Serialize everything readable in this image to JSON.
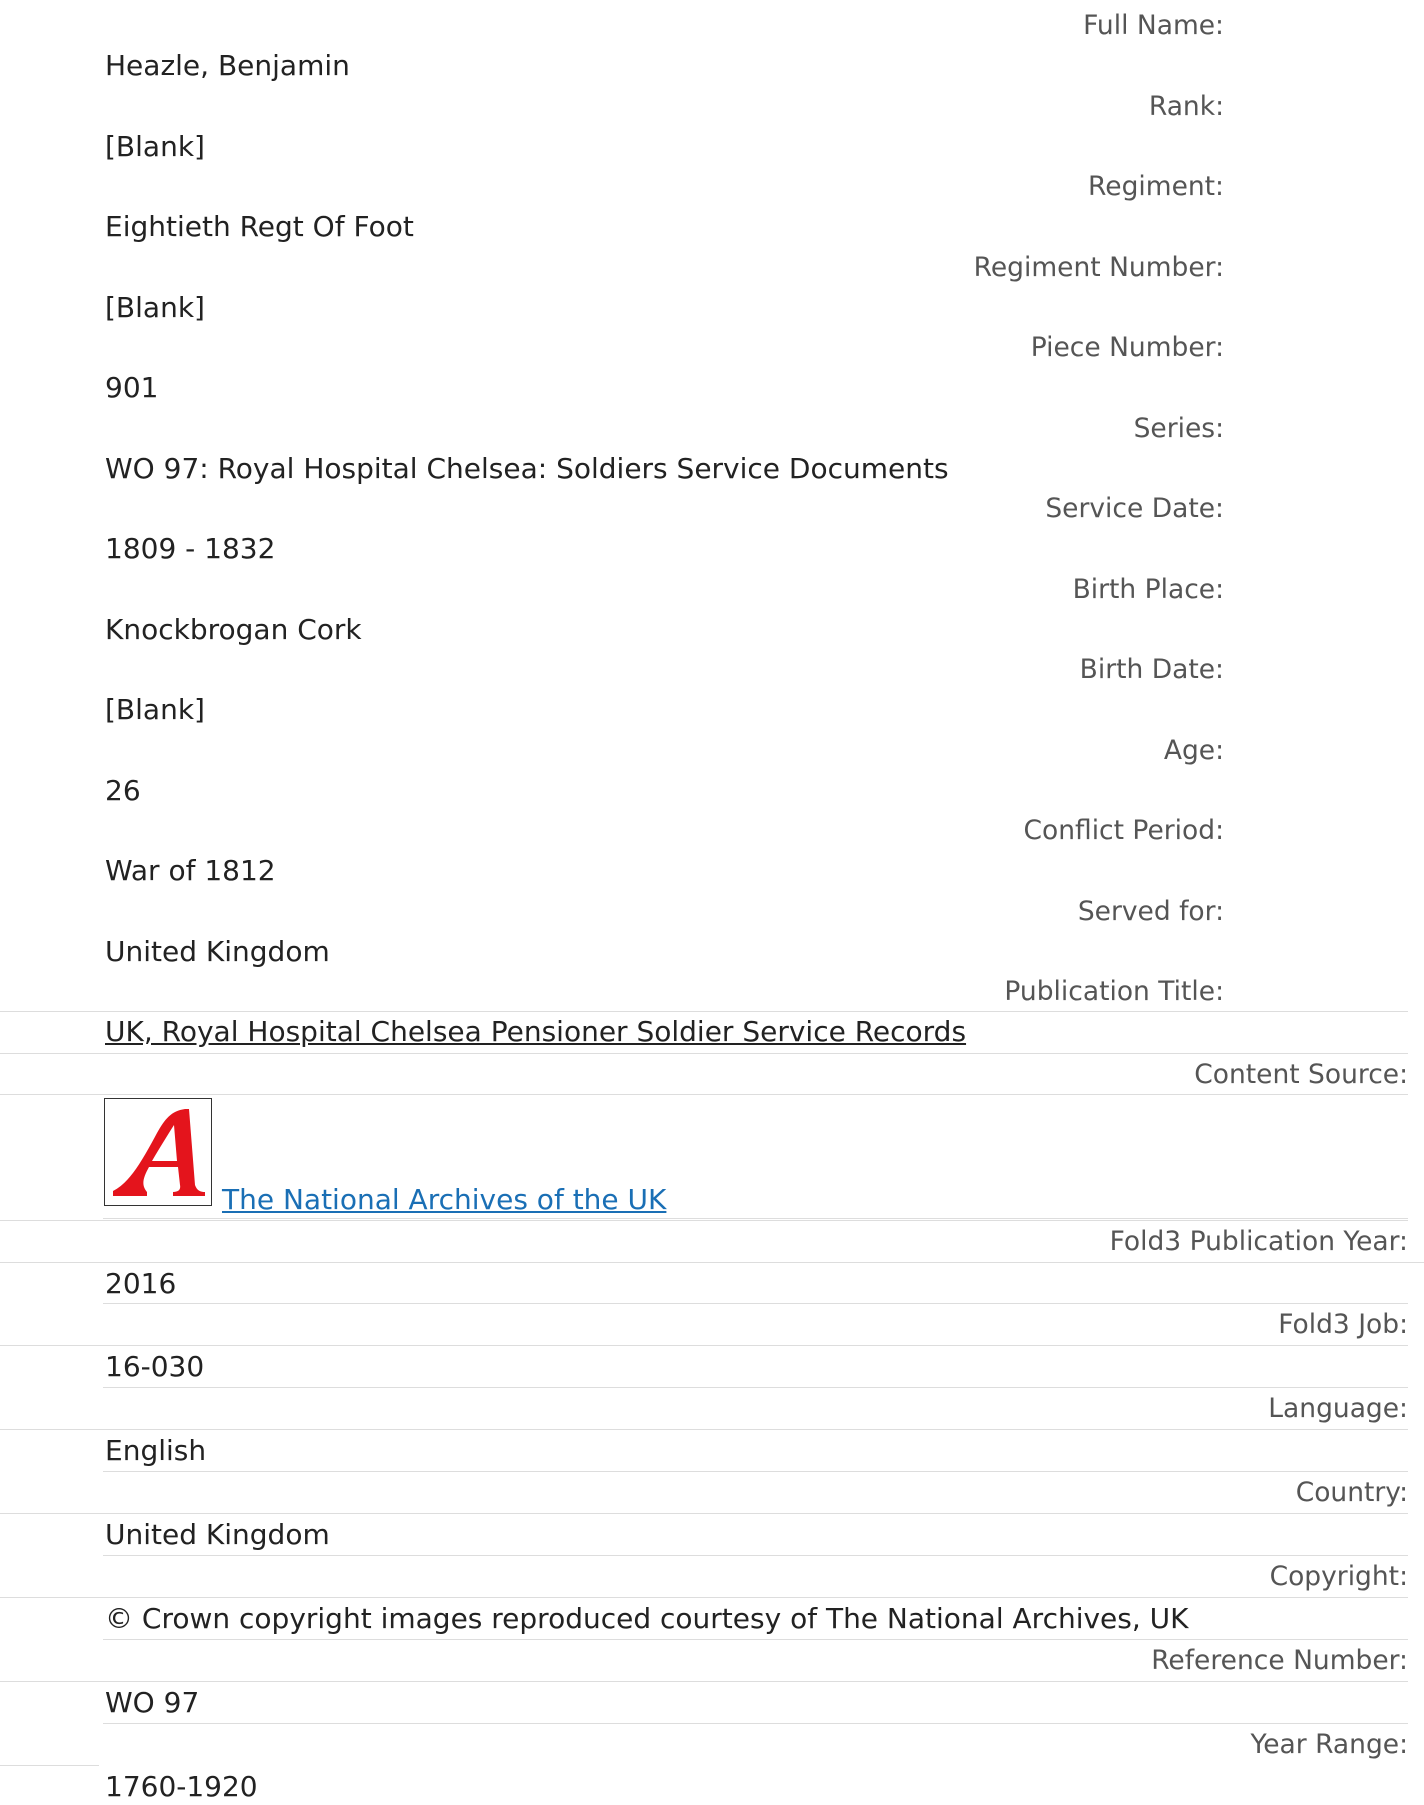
{
  "record": {
    "full_name_label": "Full Name:",
    "full_name": "Heazle, Benjamin",
    "rank_label": "Rank:",
    "rank": "[Blank]",
    "regiment_label": "Regiment:",
    "regiment": "Eightieth Regt Of Foot",
    "regiment_number_label": "Regiment Number:",
    "regiment_number": "[Blank]",
    "piece_number_label": "Piece Number:",
    "piece_number": "901",
    "series_label": "Series:",
    "series": "WO 97: Royal Hospital Chelsea: Soldiers Service Documents",
    "service_date_label": "Service Date:",
    "service_date": "1809 - 1832",
    "birth_place_label": "Birth Place:",
    "birth_place": "Knockbrogan Cork",
    "birth_date_label": "Birth Date:",
    "birth_date": "[Blank]",
    "age_label": "Age:",
    "age": "26",
    "conflict_period_label": "Conflict Period:",
    "conflict_period": "War of 1812",
    "served_for_label": "Served for:",
    "served_for": "United Kingdom"
  },
  "publication": {
    "title_label": "Publication Title:",
    "title_link": "UK, Royal Hospital Chelsea Pensioner Soldier Service Records",
    "content_source_label": "Content Source:",
    "content_source_logo_icon": "national-archives-logo",
    "content_source_logo_color": "#e4141c",
    "content_source_link": "The National Archives of the UK",
    "fold3_year_label": "Fold3 Publication Year:",
    "fold3_year": "2016",
    "fold3_job_label": "Fold3 Job:",
    "fold3_job": "16-030",
    "language_label": "Language:",
    "language": "English",
    "country_label": "Country:",
    "country": "United Kingdom",
    "copyright_label": "Copyright:",
    "copyright": "© Crown copyright images reproduced courtesy of The National Archives, UK",
    "reference_number_label": "Reference Number:",
    "reference_number": "WO 97",
    "year_range_label": "Year Range:",
    "year_range": "1760-1920"
  },
  "colors": {
    "link": "#1a6fb5",
    "label_text": "#555555",
    "value_text": "#222222",
    "rule": "#dddddd"
  }
}
